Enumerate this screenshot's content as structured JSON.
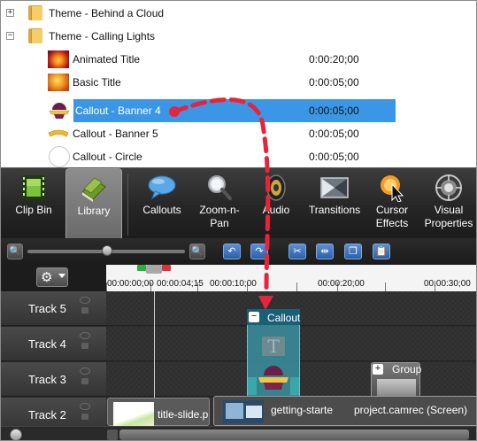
{
  "library_tree": {
    "items": [
      {
        "type": "folder",
        "toggle": "+",
        "label": "Theme - Behind a Cloud",
        "duration": ""
      },
      {
        "type": "folder",
        "toggle": "−",
        "label": "Theme - Calling Lights",
        "duration": ""
      },
      {
        "type": "asset",
        "label": "Animated Title",
        "duration": "0:00:20;00"
      },
      {
        "type": "asset",
        "label": "Basic Title",
        "duration": "0:00:05;00"
      },
      {
        "type": "asset",
        "label": "Callout - Banner 4",
        "duration": "0:00:05;00",
        "selected": true
      },
      {
        "type": "asset",
        "label": "Callout - Banner 5",
        "duration": "0:00:05;00"
      },
      {
        "type": "asset",
        "label": "Callout - Circle",
        "duration": "0:00:05;00"
      }
    ]
  },
  "toolbar": {
    "tabs": [
      {
        "label": "Clip Bin",
        "icon": "film-icon"
      },
      {
        "label": "Library",
        "icon": "library-books-icon",
        "active": true
      }
    ],
    "tools": [
      {
        "label": "Callouts",
        "icon": "speech-bubble-icon"
      },
      {
        "label": "Zoom-n-\nPan",
        "icon": "magnifier-icon"
      },
      {
        "label": "Audio",
        "icon": "speaker-icon"
      },
      {
        "label": "Transitions",
        "icon": "transitions-icon"
      },
      {
        "label": "Cursor\nEffects",
        "icon": "cursor-effects-icon"
      },
      {
        "label": "Visual\nProperties",
        "icon": "visual-properties-icon"
      }
    ]
  },
  "ruler": {
    "labels": [
      "00:00:00;00",
      "00:00:04;15",
      "00:00:10;00",
      "00:00:20;00",
      "00:00:30;00"
    ]
  },
  "tracks": [
    {
      "name": "Track 5"
    },
    {
      "name": "Track 4"
    },
    {
      "name": "Track 3"
    },
    {
      "name": "Track 2"
    }
  ],
  "clips": {
    "callout": {
      "toggle": "−",
      "label": "Callout"
    },
    "group": {
      "toggle": "+",
      "label": "Group"
    },
    "title_slide": {
      "label": "title-slide.p"
    },
    "recording": {
      "label": "getting-starte",
      "label_tail": "project.camrec (Screen)"
    }
  },
  "colors": {
    "selection": "#3b97e5",
    "drag_arrow": "#e8243a",
    "callout_clip": "#3a8fa0"
  }
}
